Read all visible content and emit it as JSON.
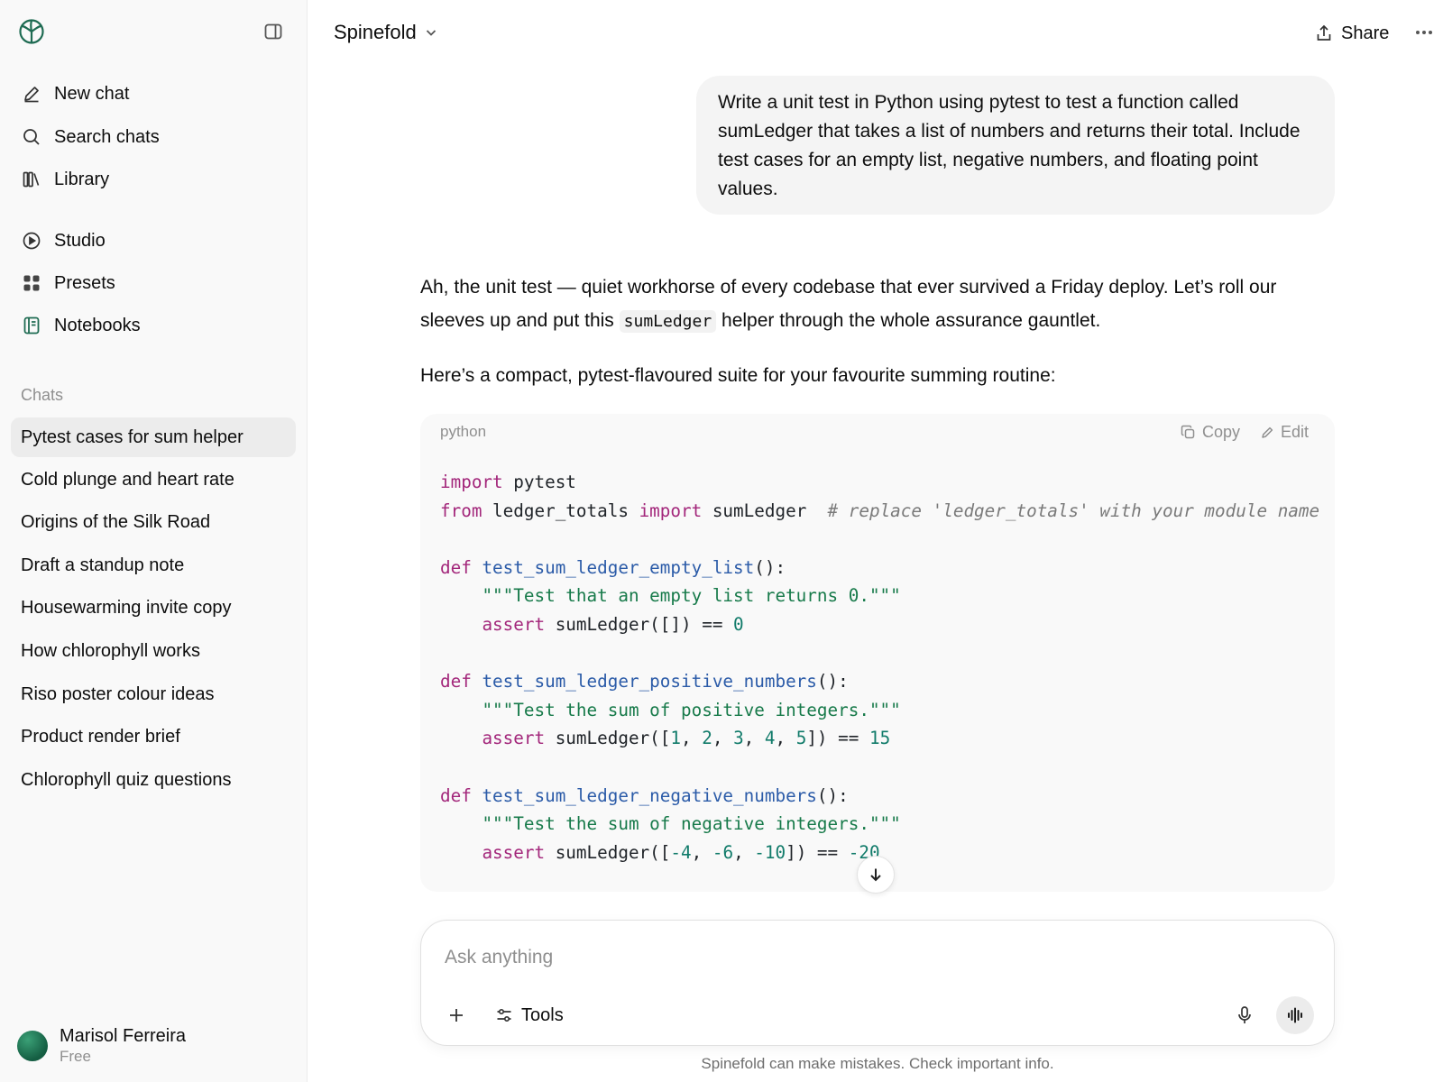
{
  "sidebar": {
    "logo_icon": "spiral-logo-icon",
    "nav": [
      {
        "label": "New chat",
        "icon": "pencil-icon"
      },
      {
        "label": "Search chats",
        "icon": "search-icon"
      },
      {
        "label": "Library",
        "icon": "library-icon"
      },
      {
        "label": "Studio",
        "icon": "play-circle-icon"
      },
      {
        "label": "Presets",
        "icon": "grid-icon"
      },
      {
        "label": "Notebooks",
        "icon": "notebook-icon"
      }
    ],
    "chats_label": "Chats",
    "chats": [
      "Pytest cases for sum helper",
      "Cold plunge and heart rate",
      "Origins of the Silk Road",
      "Draft a standup note",
      "Housewarming invite copy",
      "How chlorophyll works",
      "Riso poster colour ideas",
      "Product render brief",
      "Chlorophyll quiz questions"
    ],
    "active_chat_index": 0,
    "user": {
      "name": "Marisol Ferreira",
      "plan": "Free"
    }
  },
  "header": {
    "model_name": "Spinefold",
    "share_label": "Share"
  },
  "conversation": {
    "user_message": "Write a unit test in Python using pytest to test a function called sumLedger that takes a list of numbers and returns their total. Include test cases for an empty list, negative numbers, and floating point values.",
    "assistant": {
      "p1_before": "Ah, the unit test — quiet workhorse of every codebase that ever survived a Friday deploy. Let’s roll our sleeves up and put this ",
      "p1_code": "sumLedger",
      "p1_after": " helper through the whole assurance gauntlet.",
      "p2": "Here’s a compact, pytest-flavoured suite for your favourite summing routine:",
      "code": {
        "language": "python",
        "copy_label": "Copy",
        "edit_label": "Edit",
        "lines": [
          [
            [
              "kw",
              "import"
            ],
            [
              "p",
              " pytest"
            ]
          ],
          [
            [
              "kw",
              "from"
            ],
            [
              "p",
              " ledger_totals "
            ],
            [
              "kw",
              "import"
            ],
            [
              "p",
              " sumLedger  "
            ],
            [
              "cm",
              "# replace 'ledger_totals' with your module name"
            ]
          ],
          [],
          [
            [
              "kw",
              "def"
            ],
            [
              "p",
              " "
            ],
            [
              "fn",
              "test_sum_ledger_empty_list"
            ],
            [
              "p",
              "():"
            ]
          ],
          [
            [
              "p",
              "    "
            ],
            [
              "str",
              "\"\"\"Test that an empty list returns 0.\"\"\""
            ]
          ],
          [
            [
              "p",
              "    "
            ],
            [
              "kw",
              "assert"
            ],
            [
              "p",
              " sumLedger([]) == "
            ],
            [
              "num",
              "0"
            ]
          ],
          [],
          [
            [
              "kw",
              "def"
            ],
            [
              "p",
              " "
            ],
            [
              "fn",
              "test_sum_ledger_positive_numbers"
            ],
            [
              "p",
              "():"
            ]
          ],
          [
            [
              "p",
              "    "
            ],
            [
              "str",
              "\"\"\"Test the sum of positive integers.\"\"\""
            ]
          ],
          [
            [
              "p",
              "    "
            ],
            [
              "kw",
              "assert"
            ],
            [
              "p",
              " sumLedger(["
            ],
            [
              "num",
              "1"
            ],
            [
              "p",
              ", "
            ],
            [
              "num",
              "2"
            ],
            [
              "p",
              ", "
            ],
            [
              "num",
              "3"
            ],
            [
              "p",
              ", "
            ],
            [
              "num",
              "4"
            ],
            [
              "p",
              ", "
            ],
            [
              "num",
              "5"
            ],
            [
              "p",
              "]) == "
            ],
            [
              "num",
              "15"
            ]
          ],
          [],
          [
            [
              "kw",
              "def"
            ],
            [
              "p",
              " "
            ],
            [
              "fn",
              "test_sum_ledger_negative_numbers"
            ],
            [
              "p",
              "():"
            ]
          ],
          [
            [
              "p",
              "    "
            ],
            [
              "str",
              "\"\"\"Test the sum of negative integers.\"\"\""
            ]
          ],
          [
            [
              "p",
              "    "
            ],
            [
              "kw",
              "assert"
            ],
            [
              "p",
              " sumLedger(["
            ],
            [
              "num",
              "-4"
            ],
            [
              "p",
              ", "
            ],
            [
              "num",
              "-6"
            ],
            [
              "p",
              ", "
            ],
            [
              "num",
              "-10"
            ],
            [
              "p",
              "]) == "
            ],
            [
              "num",
              "-20"
            ]
          ]
        ]
      }
    }
  },
  "composer": {
    "placeholder": "Ask anything",
    "tools_label": "Tools"
  },
  "disclaimer": "Spinefold can make mistakes. Check important info.",
  "colors": {
    "keyword": "#a3277b",
    "function": "#2b5ba8",
    "string": "#177a4a",
    "number": "#117b6a",
    "comment": "#7a7a7a",
    "active_chat_bg": "#ececec",
    "avatar": "#1f7a56"
  }
}
